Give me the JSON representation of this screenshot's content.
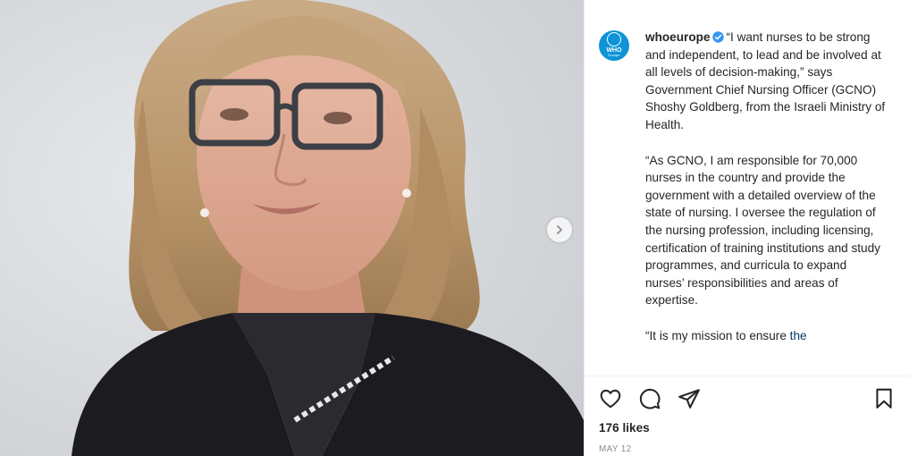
{
  "post": {
    "username": "whoeurope",
    "avatar_text": "WHO",
    "avatar_subtext": "Europe",
    "caption_p1": "“I want nurses to be strong and independent, to lead and be involved at all levels of decision-making,” says Government Chief Nursing Officer (GCNO) Shoshy Goldberg, from the Israeli Ministry of Health.",
    "caption_p2": "“As GCNO, I am responsible for 70,000 nurses in the country and provide the government with a detailed overview of the state of nursing. I oversee the regulation of the nursing profession, including licensing, certification of training institutions and study programmes, and curricula to expand nurses’ responsibilities and areas of expertise.",
    "caption_p3_start": "“It is my mission to ensure ",
    "caption_p3_link": "the",
    "likes": "176 likes",
    "date": "MAY 12"
  },
  "icons": {
    "verified": "verified-badge-icon",
    "carousel_next": "chevron-right-icon",
    "like": "heart-icon",
    "comment": "comment-icon",
    "share": "send-icon",
    "save": "bookmark-icon"
  },
  "colors": {
    "brand": "#0d93d6",
    "verified": "#3897f0",
    "text": "#262626",
    "muted": "#8e8e8e"
  }
}
